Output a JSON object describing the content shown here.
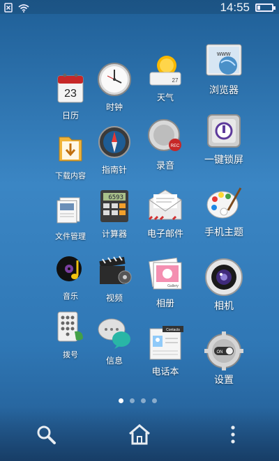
{
  "status_bar": {
    "time": "14:55",
    "icons": [
      "sim-missing-icon",
      "wifi-icon",
      "battery-icon"
    ]
  },
  "apps": [
    {
      "label": "日历",
      "icon": "calendar-icon",
      "calendar_day": "23"
    },
    {
      "label": "时钟",
      "icon": "clock-icon"
    },
    {
      "label": "天气",
      "icon": "weather-icon",
      "temp": "27"
    },
    {
      "label": "浏览器",
      "icon": "browser-icon",
      "badge_text": "www"
    },
    {
      "label": "下载内容",
      "icon": "download-icon"
    },
    {
      "label": "指南针",
      "icon": "compass-icon"
    },
    {
      "label": "录音",
      "icon": "recorder-icon",
      "badge_text": "REC"
    },
    {
      "label": "一键锁屏",
      "icon": "lock-screen-icon"
    },
    {
      "label": "文件管理",
      "icon": "file-manager-icon"
    },
    {
      "label": "计算器",
      "icon": "calculator-icon",
      "display": "6593"
    },
    {
      "label": "电子邮件",
      "icon": "email-icon"
    },
    {
      "label": "手机主题",
      "icon": "theme-palette-icon"
    },
    {
      "label": "音乐",
      "icon": "music-icon"
    },
    {
      "label": "视频",
      "icon": "video-icon"
    },
    {
      "label": "相册",
      "icon": "gallery-icon",
      "badge_text": "Gallery"
    },
    {
      "label": "相机",
      "icon": "camera-icon"
    },
    {
      "label": "拨号",
      "icon": "dialer-icon"
    },
    {
      "label": "信息",
      "icon": "messaging-icon"
    },
    {
      "label": "电话本",
      "icon": "contacts-icon",
      "badge_text": "Contacts"
    },
    {
      "label": "设置",
      "icon": "settings-icon",
      "badge_text": "ON"
    }
  ],
  "pager": {
    "pages": 4,
    "active": 1
  },
  "dock": {
    "icons": [
      "search-icon",
      "home-icon",
      "menu-icon"
    ]
  },
  "colors": {
    "wallpaper_top": "#1f5f97",
    "wallpaper_mid": "#3b86c4",
    "wallpaper_bottom": "#21588e",
    "text": "#ffffff"
  }
}
